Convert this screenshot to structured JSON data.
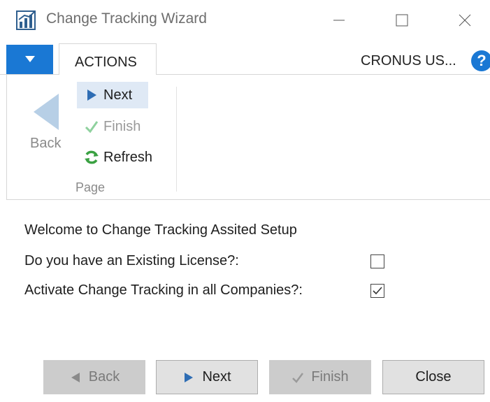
{
  "window": {
    "title": "Change Tracking Wizard",
    "icon": "nav-chart-icon",
    "controls": [
      "minimize-icon",
      "maximize-icon",
      "close-icon"
    ]
  },
  "ribbon": {
    "app_menu_icon": "triangle-down-icon",
    "tab": "ACTIONS",
    "company": "CRONUS US...",
    "help_glyph": "?",
    "back_label": "Back",
    "next_label": "Next",
    "finish_label": "Finish",
    "refresh_label": "Refresh",
    "group_label": "Page"
  },
  "content": {
    "welcome": "Welcome to Change Tracking Assited Setup",
    "fields": [
      {
        "label": "Do you have an Existing License?:",
        "checked": false
      },
      {
        "label": "Activate Change Tracking in all Companies?:",
        "checked": true
      }
    ]
  },
  "footer": {
    "back": "Back",
    "next": "Next",
    "finish": "Finish",
    "close": "Close"
  },
  "colors": {
    "accent": "#1a78d4",
    "next_icon": "#2e6db4",
    "finish_icon": "#8fd19e",
    "refresh_icon": "#3aa142",
    "disabled_button": "#cccccc"
  }
}
